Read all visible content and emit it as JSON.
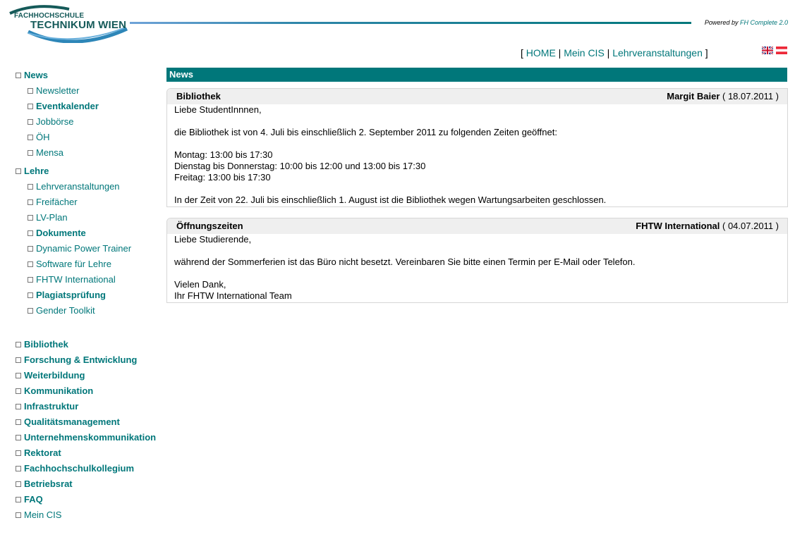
{
  "header": {
    "logo": {
      "line1": "FACHHOCHSCHULE",
      "line2": "TECHNIKUM WIEN"
    },
    "powered_prefix": "Powered by",
    "powered_link": "FH Complete 2.0"
  },
  "topnav": {
    "open": "[",
    "sep": "|",
    "close": "]",
    "items": [
      "HOME",
      "Mein CIS",
      "Lehrveranstaltungen"
    ]
  },
  "flags": [
    "uk-flag-icon",
    "austria-flag-icon"
  ],
  "sidebar": {
    "news": {
      "label": "News",
      "items": [
        {
          "label": "Newsletter",
          "bold": false
        },
        {
          "label": "Eventkalender",
          "bold": true
        },
        {
          "label": "Jobbörse",
          "bold": false
        },
        {
          "label": "ÖH",
          "bold": false
        },
        {
          "label": "Mensa",
          "bold": false
        }
      ]
    },
    "lehre": {
      "label": "Lehre",
      "items": [
        {
          "label": "Lehrveranstaltungen",
          "bold": false
        },
        {
          "label": "Freifächer",
          "bold": false
        },
        {
          "label": "LV-Plan",
          "bold": false
        },
        {
          "label": "Dokumente",
          "bold": true
        },
        {
          "label": "Dynamic Power Trainer",
          "bold": false
        },
        {
          "label": "Software für Lehre",
          "bold": false
        },
        {
          "label": "FHTW International",
          "bold": false
        },
        {
          "label": "Plagiatsprüfung",
          "bold": true
        },
        {
          "label": "Gender Toolkit",
          "bold": false
        }
      ]
    },
    "sections": [
      "Bibliothek",
      "Forschung & Entwicklung",
      "Weiterbildung",
      "Kommunikation",
      "Infrastruktur",
      "Qualitätsmanagement",
      "Unternehmenskommunikation",
      "Rektorat",
      "Fachhochschulkollegium",
      "Betriebsrat",
      "FAQ"
    ],
    "last": "Mein CIS"
  },
  "main": {
    "heading": "News",
    "news": [
      {
        "title": "Bibliothek",
        "author": "Margit Baier",
        "date": "( 18.07.2011 )",
        "lines": [
          "Liebe StudentInnnen,",
          "",
          "die Bibliothek ist von 4. Juli bis einschließlich 2. September 2011 zu folgenden Zeiten geöffnet:",
          "",
          "Montag: 13:00 bis 17:30",
          "Dienstag bis Donnerstag: 10:00 bis 12:00 und 13:00 bis 17:30",
          "Freitag: 13:00 bis 17:30",
          "",
          "In der Zeit von 22. Juli bis einschließlich 1. August ist die Bibliothek wegen Wartungsarbeiten geschlossen."
        ]
      },
      {
        "title": "Öffnungszeiten",
        "author": "FHTW International",
        "date": "( 04.07.2011 )",
        "lines": [
          "Liebe Studierende,",
          "",
          "während der Sommerferien ist das Büro nicht besetzt. Vereinbaren Sie bitte einen Termin per E-Mail oder Telefon.",
          "",
          "Vielen Dank,",
          "Ihr FHTW International Team"
        ]
      }
    ]
  }
}
